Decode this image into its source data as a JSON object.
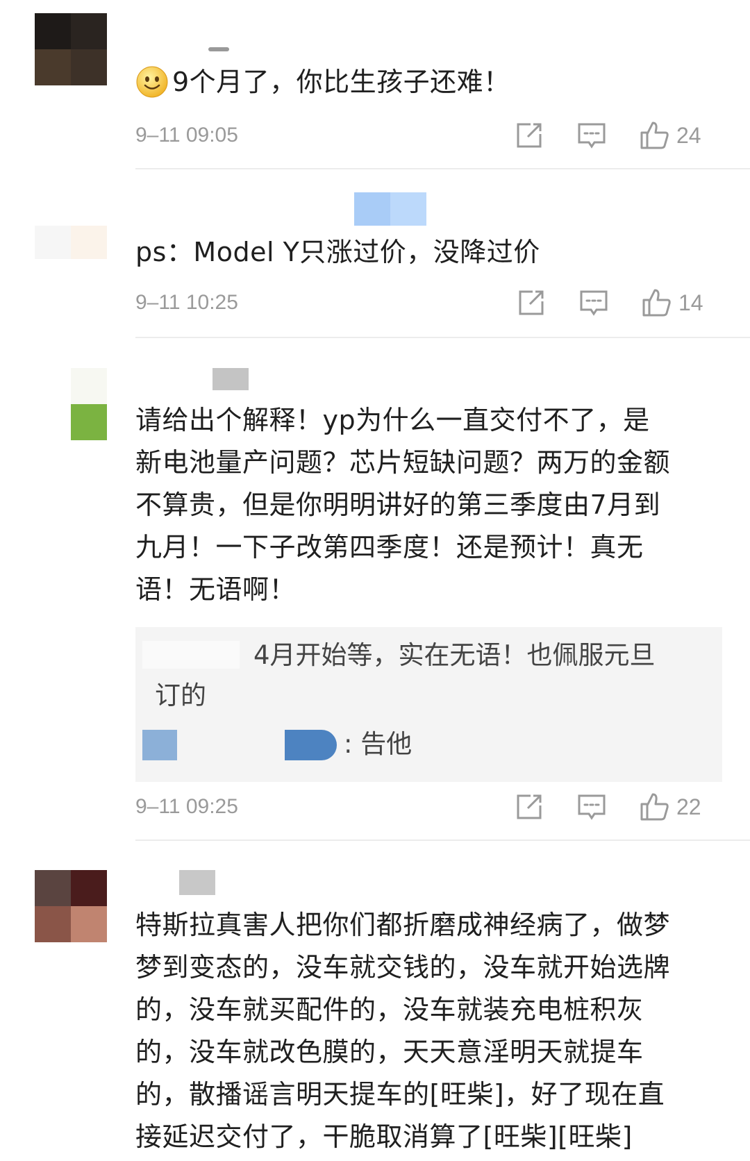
{
  "comments": [
    {
      "text": "9个月了，你比生孩子还难！",
      "time": "9–11 09:05",
      "likes": "24",
      "emoji_icon": "smile-emoji-icon"
    },
    {
      "text": "ps：Model Y只涨过价，没降过价",
      "time": "9–11 10:25",
      "likes": "14"
    },
    {
      "text_lines": [
        "请给出个解释！yp为什么一直交付不了，是",
        "新电池量产问题？芯片短缺问题？两万的金额",
        "不算贵，但是你明明讲好的第三季度由7月到",
        "九月！一下子改第四季度！还是预计！真无",
        "语！无语啊！"
      ],
      "reply": {
        "line1": "4月开始等，实在无语！也佩服元旦",
        "line2": "订的",
        "line3": ": 告他"
      },
      "time": "9–11 09:25",
      "likes": "22"
    },
    {
      "text_lines": [
        "特斯拉真害人把你们都折磨成神经病了，做梦",
        "梦到变态的，没车就交钱的，没车就开始选牌",
        "的，没车就买配件的，没车就装充电桩积灰",
        "的，没车就改色膜的，天天意淫明天就提车",
        "的，散播谣言明天提车的[旺柴]，好了现在直",
        "接延迟交付了，干脆取消算了[旺柴][旺柴]"
      ]
    }
  ],
  "icons": {
    "share": "share-icon",
    "comment": "comment-icon",
    "like": "thumbs-up-icon"
  },
  "colors": {
    "text": "#1f1f1f",
    "meta": "#9a9a9a",
    "reply_bg": "#f4f4f4",
    "divider": "#ececec"
  }
}
